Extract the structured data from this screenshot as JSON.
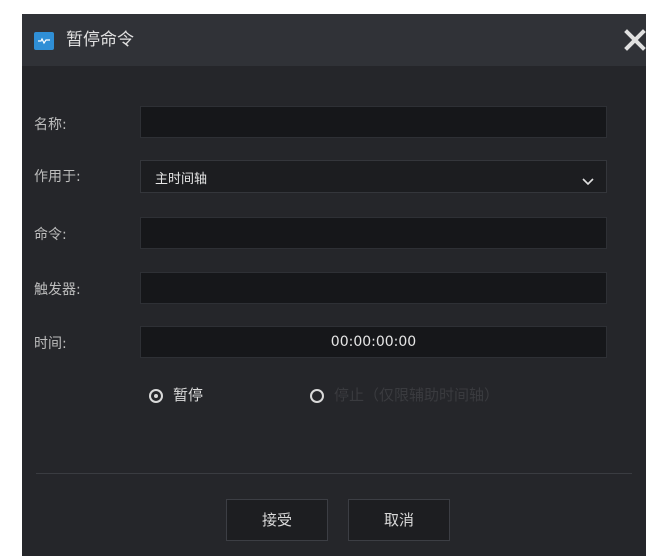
{
  "dialog": {
    "title": "暂停命令",
    "icon": "app-icon",
    "close_icon": "close-icon"
  },
  "form": {
    "name": {
      "label": "名称:",
      "value": ""
    },
    "apply_to": {
      "label": "作用于:",
      "value": "主时间轴"
    },
    "command": {
      "label": "命令:",
      "value": ""
    },
    "trigger": {
      "label": "触发器:",
      "value": ""
    },
    "time": {
      "label": "时间:",
      "value": "00:00:00:00"
    }
  },
  "options": {
    "pause": {
      "label": "暂停",
      "selected": true
    },
    "stop": {
      "label": "停止（仅限辅助时间轴）",
      "selected": false,
      "disabled": true
    }
  },
  "buttons": {
    "accept": "接受",
    "cancel": "取消"
  },
  "colors": {
    "background": "#25262a",
    "titlebar": "#303237",
    "field": "#16171a",
    "accent_icon": "#2f8fd6"
  }
}
